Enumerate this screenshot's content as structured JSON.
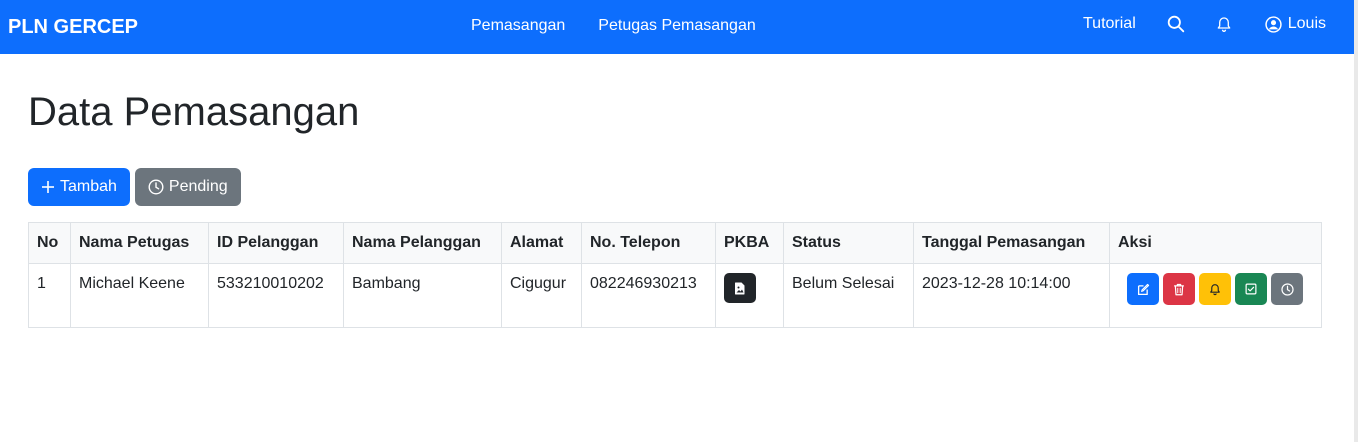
{
  "navbar": {
    "brand": "PLN GERCEP",
    "links": [
      "Pemasangan",
      "Petugas Pemasangan"
    ],
    "tutorial": "Tutorial",
    "user": "Louis",
    "color": "#0d6efd"
  },
  "page": {
    "title": "Data Pemasangan",
    "tambah_label": "Tambah",
    "pending_label": "Pending"
  },
  "table": {
    "headers": [
      "No",
      "Nama Petugas",
      "ID Pelanggan",
      "Nama Pelanggan",
      "Alamat",
      "No. Telepon",
      "PKBA",
      "Status",
      "Tanggal Pemasangan",
      "Aksi"
    ],
    "rows": [
      {
        "no": "1",
        "nama_petugas": "Michael Keene",
        "id_pelanggan": "533210010202",
        "nama_pelanggan": "Bambang",
        "alamat": "Cigugur",
        "no_telepon": "082246930213",
        "status": "Belum Selesai",
        "tanggal": "2023-12-28 10:14:00"
      }
    ]
  },
  "action_colors": {
    "edit": "#0d6efd",
    "delete": "#dc3545",
    "notify": "#ffc107",
    "complete": "#198754",
    "pending": "#6c757d"
  },
  "icons": [
    "search-icon",
    "bell-icon",
    "user-circle-icon",
    "plus-icon",
    "clock-icon",
    "image-file-icon",
    "edit-icon",
    "trash-icon",
    "bell-icon",
    "check-square-icon",
    "clock-icon"
  ]
}
